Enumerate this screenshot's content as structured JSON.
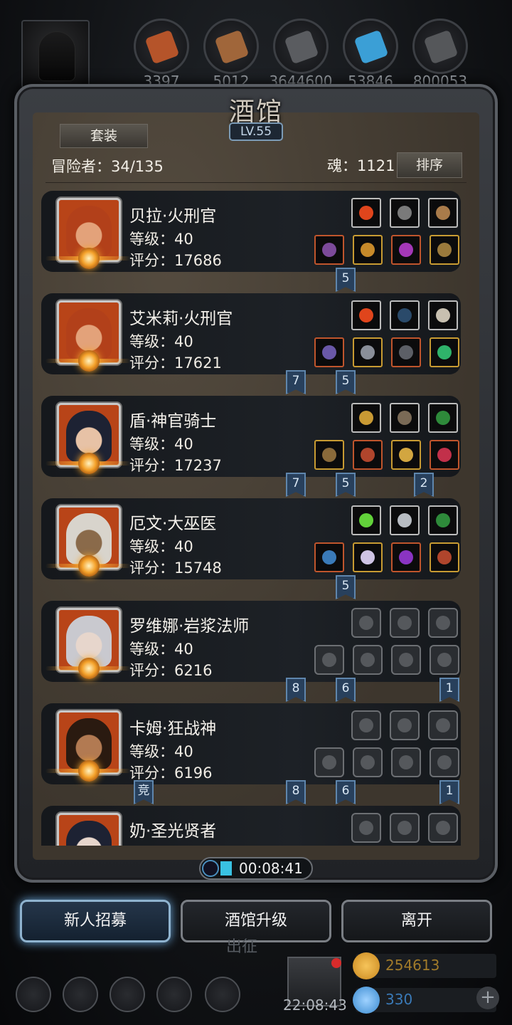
{
  "top_bar": {
    "resources": [
      {
        "icon": "meat-resource-icon",
        "value": "3397",
        "color": "#b5542a"
      },
      {
        "icon": "wood-resource-icon",
        "value": "5012",
        "color": "#a0663a"
      },
      {
        "icon": "iron-resource-icon",
        "value": "3644600",
        "color": "#5a5c60"
      },
      {
        "icon": "crystal-resource-icon",
        "value": "53846",
        "color": "#3b9fd6"
      },
      {
        "icon": "stone-resource-icon",
        "value": "800053",
        "color": "#55575a"
      }
    ]
  },
  "tavern": {
    "title": "酒馆",
    "level": "LV.55",
    "suit_button": "套装",
    "adventurers": "冒险者：34/135",
    "soul": "魂：1121",
    "sort_button": "排序"
  },
  "heroes": [
    {
      "name": "贝拉·火刑官",
      "level": "等级：40",
      "score": "评分：17686",
      "skin": "#e3a27a",
      "hair": "#b2401a",
      "skills": [
        "#e0451c",
        "#7a7a7a",
        "#a97b4a"
      ],
      "gear": [
        "#7c4a9a",
        "#c78a2a",
        "#a438b8",
        "#9b7a3c"
      ],
      "gear_borders": [
        "red",
        "gold",
        "red",
        "gold"
      ],
      "ribbons": [
        {
          "text": "5",
          "col": 1
        }
      ]
    },
    {
      "name": "艾米莉·火刑官",
      "level": "等级：40",
      "score": "评分：17621",
      "skin": "#e3a27a",
      "hair": "#b2401a",
      "skills": [
        "#e0451c",
        "#2a4a6a",
        "#c8c0b0"
      ],
      "gear": [
        "#6a58a8",
        "#8a8f99",
        "#5c5f66",
        "#2fb36a"
      ],
      "gear_borders": [
        "red",
        "gold",
        "red",
        "gold"
      ],
      "ribbons": [
        {
          "text": "7",
          "col": 0
        },
        {
          "text": "5",
          "col": 1
        }
      ]
    },
    {
      "name": "盾·神官骑士",
      "level": "等级：40",
      "score": "评分：17237",
      "skin": "#e7c2a6",
      "hair": "#1d2233",
      "skills": [
        "#c99a34",
        "#7a6a56",
        "#2e8a3a"
      ],
      "gear": [
        "#8a6a3a",
        "#b0452c",
        "#d2a640",
        "#c2304a"
      ],
      "gear_borders": [
        "gold",
        "red",
        "gold",
        "red"
      ],
      "ribbons": [
        {
          "text": "7",
          "col": 0
        },
        {
          "text": "5",
          "col": 1
        },
        {
          "text": "2",
          "col": 3
        }
      ]
    },
    {
      "name": "厄文·大巫医",
      "level": "等级：40",
      "score": "评分：15748",
      "skin": "#8a6a4a",
      "hair": "#d8d4cc",
      "skills": [
        "#62d23a",
        "#b8bcc2",
        "#2e8a3a"
      ],
      "gear": [
        "#3a7ab8",
        "#cfc4e4",
        "#8a34c2",
        "#b0452c"
      ],
      "gear_borders": [
        "red",
        "gold",
        "red",
        "gold"
      ],
      "ribbons": [
        {
          "text": "5",
          "col": 1
        }
      ]
    },
    {
      "name": "罗维娜·岩浆法师",
      "level": "等级：40",
      "score": "评分：6216",
      "skin": "#e7d6cc",
      "hair": "#c9c9cf",
      "empty": true,
      "ribbons": [
        {
          "text": "8",
          "col": 0
        },
        {
          "text": "6",
          "col": 1
        },
        {
          "text": "1",
          "col": 4
        }
      ]
    },
    {
      "name": "卡姆·狂战神",
      "level": "等级：40",
      "score": "评分：6196",
      "skin": "#b27a52",
      "hair": "#2a1a10",
      "empty": true,
      "ribbons": [
        {
          "text": "竞",
          "col": -1
        },
        {
          "text": "8",
          "col": 0
        },
        {
          "text": "6",
          "col": 1
        },
        {
          "text": "1",
          "col": 4
        }
      ]
    },
    {
      "name": "奶·圣光贤者",
      "level": "",
      "score": "",
      "skin": "#e7d6cc",
      "hair": "#1d2233",
      "empty": true,
      "ribbons": []
    }
  ],
  "timer": "00:08:41",
  "buttons": {
    "recruit": "新人招募",
    "upgrade": "酒馆升级",
    "leave": "离开"
  },
  "hud": {
    "dim_label": "出征",
    "clock": "22:08:43",
    "gold": "254613",
    "gems": "330",
    "gold_color": "#c9871e",
    "gem_color": "#3a8ad0"
  }
}
